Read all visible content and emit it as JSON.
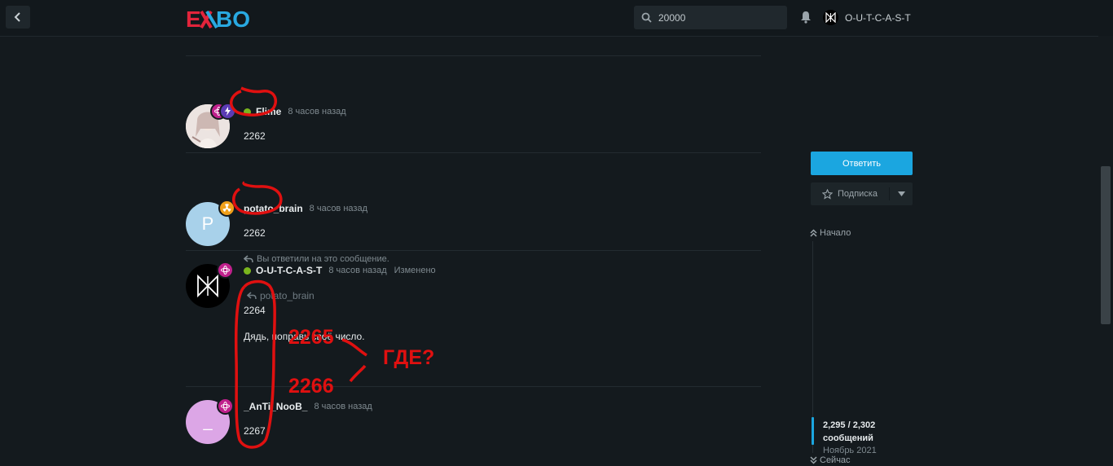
{
  "header": {
    "logo_text": "EXBO",
    "search_value": "20000",
    "username": "O-U-T-C-A-S-T"
  },
  "posts": [
    {
      "username": "Flime",
      "time": "8 часов назад",
      "message": "2262"
    },
    {
      "username": "potato_brain",
      "avatar_letter": "P",
      "time": "8 часов назад",
      "message": "2262",
      "replied_note": "Вы ответили на это сообщение."
    },
    {
      "username": "O-U-T-C-A-S-T",
      "time": "8 часов назад",
      "edited": "Изменено",
      "quote_user": "potato_brain",
      "message_line1": "2264",
      "message_line2": "Дядь, поправь своё число."
    },
    {
      "username": "_AnTi_NooB_",
      "avatar_letter": "_",
      "time": "8 часов назад",
      "message": "2267"
    }
  ],
  "sidebar": {
    "reply_button": "Ответить",
    "subscribe_button": "Подписка",
    "nav_start": "Начало",
    "count_line1": "2,295 / 2,302",
    "count_line2": "сообщений",
    "date": "Ноябрь 2021",
    "nav_now": "Сейчас"
  },
  "annotations": {
    "num_2265": "2265",
    "num_2266": "2266",
    "where": "ГДЕ?"
  },
  "colors": {
    "accent": "#1ba6e0",
    "online": "#7ab51d",
    "annotation": "#e01010",
    "background": "#141a1e"
  }
}
